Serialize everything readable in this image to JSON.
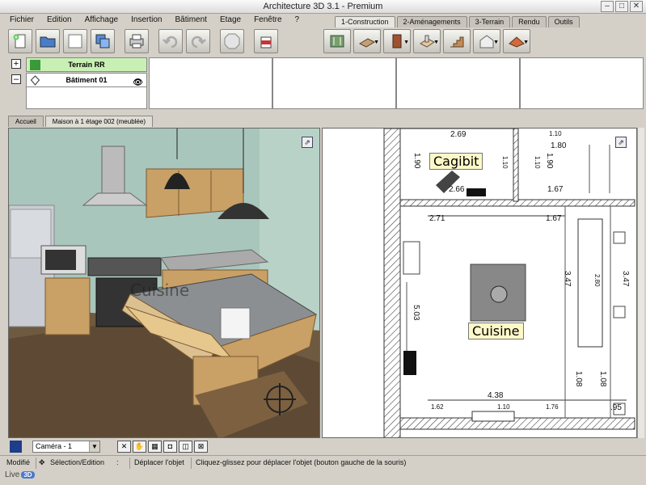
{
  "window": {
    "title": "Architecture 3D 3.1 - Premium"
  },
  "menu": [
    "Fichier",
    "Edition",
    "Affichage",
    "Insertion",
    "Bâtiment",
    "Etage",
    "Fenêtre",
    "?"
  ],
  "tabs": [
    "1-Construction",
    "2-Aménagements",
    "3-Terrain",
    "Rendu",
    "Outils"
  ],
  "levels": {
    "terrain": "Terrain RR",
    "batiment": "Bâtiment 01"
  },
  "doc_tabs": [
    "Accueil",
    "Maison à 1 étage 002 (meublée)"
  ],
  "view3d": {
    "ghost_label": "Cuisine"
  },
  "plan": {
    "rooms": {
      "cagibit": "Cagibit",
      "cuisine": "Cuisine"
    },
    "dims": {
      "d269": "2.69",
      "d110a": "1.10",
      "d180": "1.80",
      "d190a": "1.90",
      "d110b": "1.10",
      "d190b": "1.90",
      "d110c": "1.10",
      "d266": "2.66",
      "d167a": "1.67",
      "d271": "2.71",
      "d167b": "1.67",
      "d347a": "3.47",
      "d280": "2.80",
      "d347b": "3.47",
      "d503": "5.03",
      "d108a": "1.08",
      "d108b": "1.08",
      "d438": "4.38",
      "d162": "1.62",
      "d110d": "1.10",
      "d176": "1.76",
      "d95": ".95"
    }
  },
  "bottom": {
    "camera": "Caméra - 1"
  },
  "status": {
    "mode": "Modifié",
    "selection": "Sélection/Edition",
    "colon": ":",
    "action": "Déplacer l'objet",
    "hint": "Cliquez-glissez pour déplacer l'objet (bouton gauche de la souris)"
  },
  "logo": {
    "text": "Live",
    "badge": "3D"
  },
  "colors": {
    "terrain_bg": "#c9f0b4",
    "label_bg": "#fdf8c8",
    "wall": "#444444"
  }
}
